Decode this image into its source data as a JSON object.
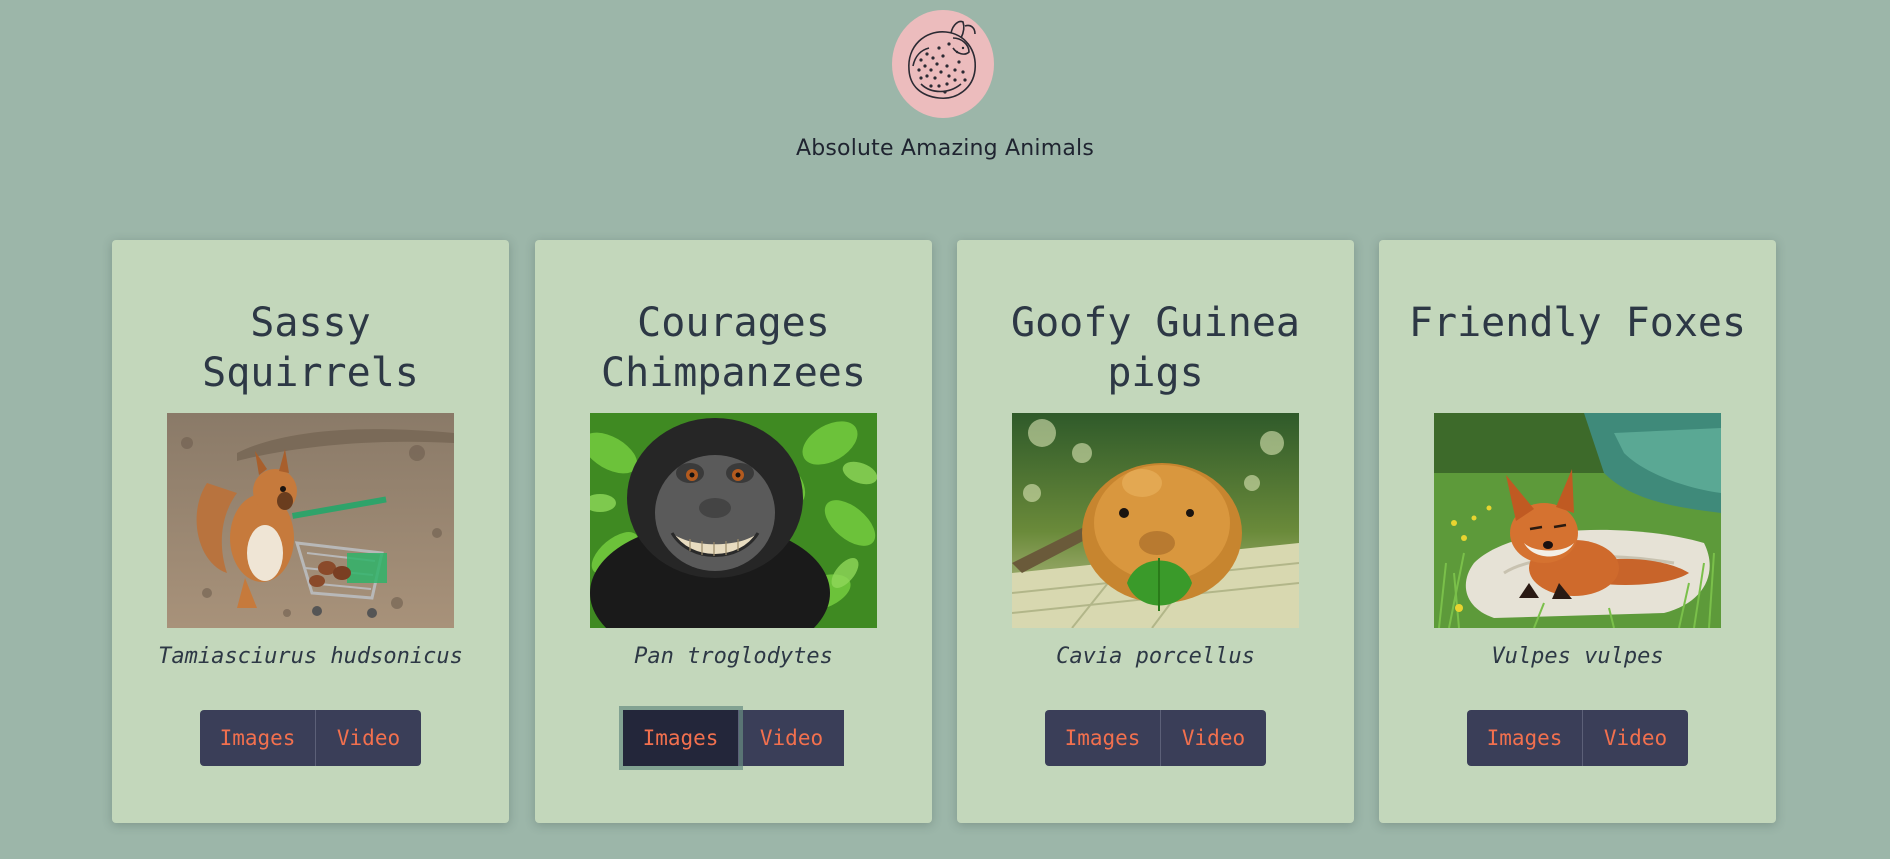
{
  "site": {
    "title": "Absolute Amazing Animals",
    "logo_icon": "curled-cheetah-logo-icon"
  },
  "colors": {
    "page_background": "#9cb6a9",
    "card_background": "#c3d7bb",
    "button_background": "#3a3e58",
    "button_active_background": "#23263a",
    "button_text": "#f2704e",
    "logo_circle": "#ecbcbd"
  },
  "cards": [
    {
      "title": "Sassy Squirrels",
      "species": "Tamiasciurus hudsonicus",
      "image_subject": "squirrel-with-shopping-cart",
      "images_label": "Images",
      "video_label": "Video"
    },
    {
      "title": "Courages Chimpanzees",
      "species": "Pan troglodytes",
      "image_subject": "smiling-macaque",
      "images_label": "Images",
      "video_label": "Video",
      "active_button": "Images"
    },
    {
      "title": "Goofy Guinea pigs",
      "species": "Cavia porcellus",
      "image_subject": "guinea-pig-eating-leaf",
      "images_label": "Images",
      "video_label": "Video"
    },
    {
      "title": "Friendly Foxes",
      "species": "Vulpes vulpes",
      "image_subject": "fox-resting-on-rock",
      "images_label": "Images",
      "video_label": "Video"
    }
  ]
}
